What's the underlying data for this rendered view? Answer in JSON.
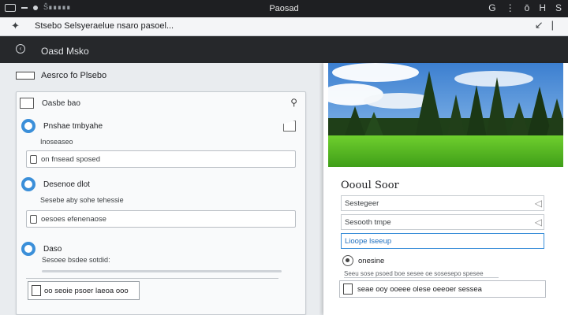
{
  "titlebar": {
    "app_tab": "Ŝ∎∎∎∎∎",
    "title": "Paosad",
    "right_glyphs": [
      "G",
      "⋮",
      "ō",
      "H",
      "S"
    ]
  },
  "toolbar": {
    "address": "Stsebo Selsyeraelue nsaro pasoel...",
    "tools_glyph": "↙"
  },
  "appbar": {
    "title": "Oasd Msko"
  },
  "left": {
    "header_label": "Aesrco fo Plsebo",
    "search_label": "Oasbe bao",
    "sections": [
      {
        "title": "Pnshae tmbyahe",
        "subtitle": "Inoseaseo",
        "field_text": "on fnsead sposed"
      },
      {
        "title": "Desenoe dlot",
        "subtitle": "Sesebe aby sohe tehessie",
        "field_text": "oesoes efenenaose"
      },
      {
        "title": "Daso",
        "subtitle": "Sesoee bsdee sotdid:",
        "button_text": "oo seoie psoer laeoa ooo"
      }
    ]
  },
  "right": {
    "title": "Oooul Soor",
    "fields": [
      {
        "text": "Sestegeer"
      },
      {
        "text": "Sesooth tmpe"
      },
      {
        "text": "Lioope lseeup"
      }
    ],
    "radio_label": "onesine",
    "description": "Seeu sose psoed boe sesee oe sosesepo spesee",
    "button_text": "seae ooy ooeee olese oeeoer sessea"
  },
  "colors": {
    "accent": "#3b8fd9",
    "titlebar_bg": "#1e1f22",
    "appbar_bg": "#26282b"
  }
}
